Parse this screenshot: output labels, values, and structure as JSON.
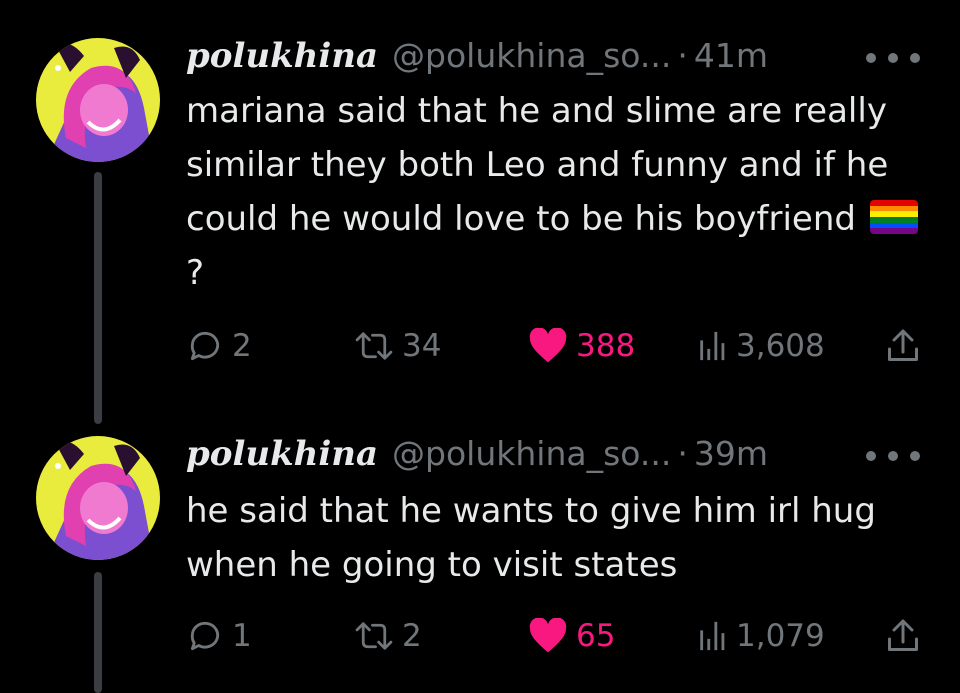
{
  "tweets": [
    {
      "display_name": "polukhina",
      "handle": "@polukhina_so...",
      "separator": "·",
      "time": "41m",
      "text": "mariana said that he and slime are really similar they both Leo and funny and if he could he would love to be his boyfriend",
      "text_suffix": "?",
      "emoji": "rainbow-flag",
      "replies": "2",
      "retweets": "34",
      "likes": "388",
      "views": "3,608"
    },
    {
      "display_name": "polukhina",
      "handle": "@polukhina_so...",
      "separator": "·",
      "time": "39m",
      "text": "he said that he wants to give him irl hug when he going to visit states",
      "replies": "1",
      "retweets": "2",
      "likes": "65",
      "views": "1,079"
    }
  ],
  "colors": {
    "background": "#000000",
    "text": "#e7e9ea",
    "muted": "#71767b",
    "like": "#f91880",
    "thread_line": "#3a3d42"
  }
}
